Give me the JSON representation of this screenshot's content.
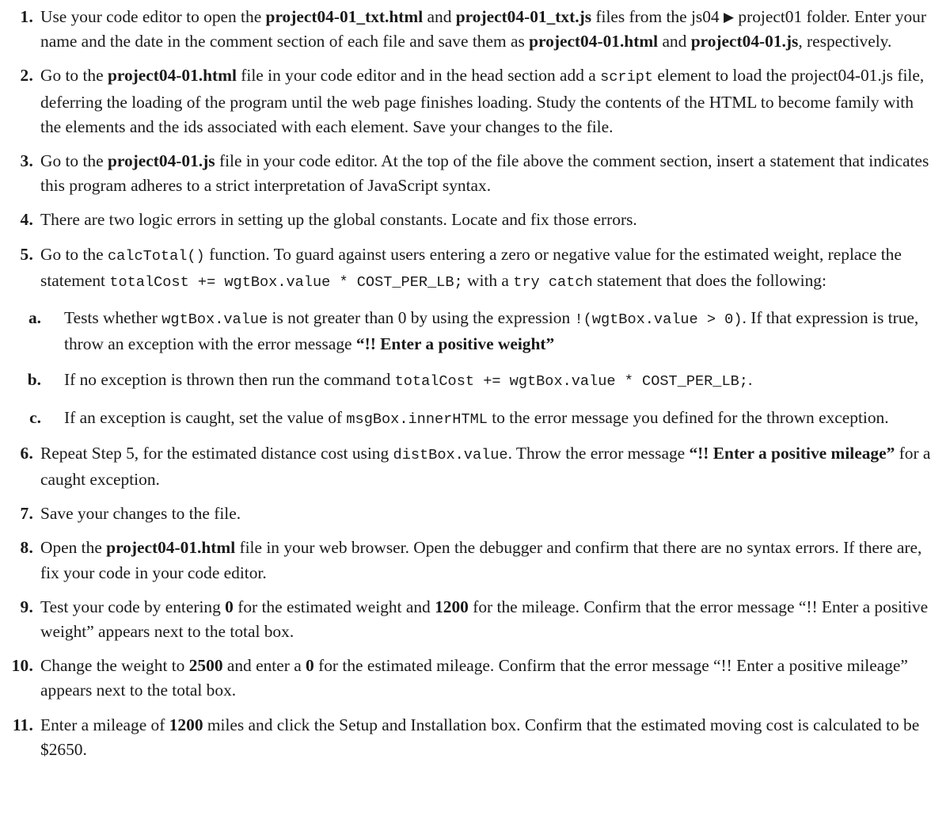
{
  "document": {
    "list_type": "ordered-numeric",
    "steps": [
      {
        "number": "1.",
        "segments": [
          {
            "t": "text",
            "v": "Use your code editor to open the "
          },
          {
            "t": "bold",
            "v": "project04-01_txt.html"
          },
          {
            "t": "text",
            "v": " and "
          },
          {
            "t": "bold",
            "v": "project04-01_txt.js"
          },
          {
            "t": "text",
            "v": " files from the js04 "
          },
          {
            "t": "icon",
            "v": "▶",
            "name": "folder-separator-arrow-icon"
          },
          {
            "t": "text",
            "v": " project01 folder. Enter your name and the date in the comment section of each file and save them as "
          },
          {
            "t": "bold",
            "v": "project04-01.html"
          },
          {
            "t": "text",
            "v": " and "
          },
          {
            "t": "bold",
            "v": "project04-01.js"
          },
          {
            "t": "text",
            "v": ", respectively."
          }
        ]
      },
      {
        "number": "2.",
        "segments": [
          {
            "t": "text",
            "v": "Go to the "
          },
          {
            "t": "bold",
            "v": "project04-01.html"
          },
          {
            "t": "text",
            "v": " file in your code editor and in the head section add a "
          },
          {
            "t": "code",
            "v": "script"
          },
          {
            "t": "text",
            "v": " element to load the project04-01.js file, deferring the loading of the program until the web page finishes loading. Study the contents of the HTML to become family with the elements and the ids associated with each element. Save your changes to the file."
          }
        ]
      },
      {
        "number": "3.",
        "segments": [
          {
            "t": "text",
            "v": "Go to the "
          },
          {
            "t": "bold",
            "v": "project04-01.js"
          },
          {
            "t": "text",
            "v": " file in your code editor. At the top of the file above the comment section, insert a statement that indicates this program adheres to a strict interpretation of JavaScript syntax."
          }
        ]
      },
      {
        "number": "4.",
        "segments": [
          {
            "t": "text",
            "v": "There are two logic errors in setting up the global constants. Locate and fix those errors."
          }
        ]
      },
      {
        "number": "5.",
        "segments": [
          {
            "t": "text",
            "v": "Go to the "
          },
          {
            "t": "code",
            "v": "calcTotal()"
          },
          {
            "t": "text",
            "v": " function. To guard against users entering a zero or negative value for the estimated weight, replace the statement "
          },
          {
            "t": "code",
            "v": "totalCost += wgtBox.value * COST_PER_LB;"
          },
          {
            "t": "text",
            "v": " with a "
          },
          {
            "t": "code",
            "v": "try catch"
          },
          {
            "t": "text",
            "v": " statement that does the following:"
          }
        ],
        "substeps": [
          {
            "letter": "a.",
            "segments": [
              {
                "t": "text",
                "v": "Tests whether "
              },
              {
                "t": "code",
                "v": "wgtBox.value"
              },
              {
                "t": "text",
                "v": " is not greater than 0 by using the expression "
              },
              {
                "t": "code",
                "v": "!(wgtBox.value > 0)"
              },
              {
                "t": "text",
                "v": ". If that expression is true, throw an exception with the error message "
              },
              {
                "t": "quote-bold",
                "v": "“!! Enter a positive weight”"
              }
            ]
          },
          {
            "letter": "b.",
            "segments": [
              {
                "t": "text",
                "v": "If no exception is thrown then run the command "
              },
              {
                "t": "code",
                "v": "totalCost += wgtBox.value * COST_PER_LB;"
              },
              {
                "t": "text",
                "v": "."
              }
            ]
          },
          {
            "letter": "c.",
            "segments": [
              {
                "t": "text",
                "v": "If an exception is caught, set the value of "
              },
              {
                "t": "code",
                "v": "msgBox.innerHTML"
              },
              {
                "t": "text",
                "v": " to the error message you defined for the thrown exception."
              }
            ]
          }
        ]
      },
      {
        "number": "6.",
        "segments": [
          {
            "t": "text",
            "v": "Repeat Step 5, for the estimated distance cost using "
          },
          {
            "t": "code",
            "v": "distBox.value"
          },
          {
            "t": "text",
            "v": ". Throw the error message "
          },
          {
            "t": "quote-bold",
            "v": "“!! Enter a positive mileage”"
          },
          {
            "t": "text",
            "v": " for a caught exception."
          }
        ]
      },
      {
        "number": "7.",
        "segments": [
          {
            "t": "text",
            "v": "Save your changes to the file."
          }
        ]
      },
      {
        "number": "8.",
        "segments": [
          {
            "t": "text",
            "v": "Open the "
          },
          {
            "t": "bold",
            "v": "project04-01.html"
          },
          {
            "t": "text",
            "v": " file in your web browser. Open the debugger and confirm that there are no syntax errors. If there are, fix your code in your code editor."
          }
        ]
      },
      {
        "number": "9.",
        "segments": [
          {
            "t": "text",
            "v": "Test your code by entering "
          },
          {
            "t": "bold",
            "v": "0"
          },
          {
            "t": "text",
            "v": " for the estimated weight and "
          },
          {
            "t": "bold",
            "v": "1200"
          },
          {
            "t": "text",
            "v": " for the mileage. Confirm that the error message “!! Enter a positive weight” appears next to the total box."
          }
        ]
      },
      {
        "number": "10.",
        "segments": [
          {
            "t": "text",
            "v": "Change the weight to "
          },
          {
            "t": "bold",
            "v": "2500"
          },
          {
            "t": "text",
            "v": " and enter a "
          },
          {
            "t": "bold",
            "v": "0"
          },
          {
            "t": "text",
            "v": " for the estimated mileage. Confirm that the error message “!! Enter a positive mileage” appears next to the total box."
          }
        ]
      },
      {
        "number": "11.",
        "segments": [
          {
            "t": "text",
            "v": "Enter a mileage of "
          },
          {
            "t": "bold",
            "v": "1200"
          },
          {
            "t": "text",
            "v": " miles and click the Setup and Installation box. Confirm that the estimated moving cost is calculated to be $2650."
          }
        ]
      }
    ]
  }
}
